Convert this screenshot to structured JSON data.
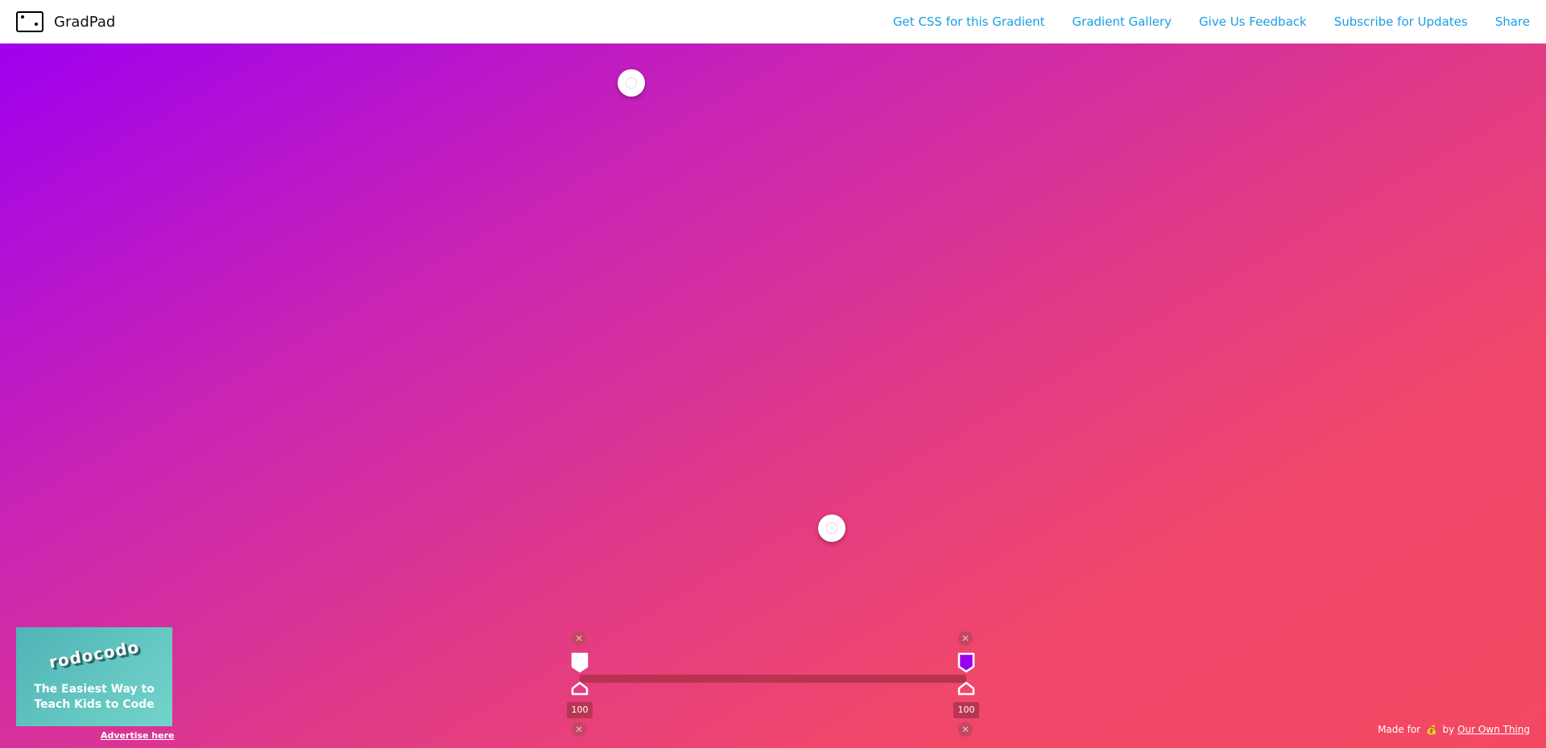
{
  "header": {
    "app_title": "GradPad",
    "nav": [
      {
        "label": "Get CSS for this Gradient"
      },
      {
        "label": "Gradient Gallery"
      },
      {
        "label": "Give Us Feedback"
      },
      {
        "label": "Subscribe for Updates"
      },
      {
        "label": "Share"
      }
    ]
  },
  "gradient": {
    "colors": [
      "#9f00ef",
      "#c924b4",
      "#e03a88",
      "#f44862"
    ]
  },
  "stops": [
    {
      "color": "#ffffff",
      "alpha_label": "100"
    },
    {
      "color": "#9900ee",
      "alpha_label": "100"
    }
  ],
  "ad": {
    "logo_text": "rodocodo",
    "line1": "The Easiest Way to",
    "line2": "Teach Kids to Code",
    "link": "Advertise here"
  },
  "footer": {
    "made_for": "Made for",
    "by": "by",
    "link": "Our Own Thing"
  }
}
